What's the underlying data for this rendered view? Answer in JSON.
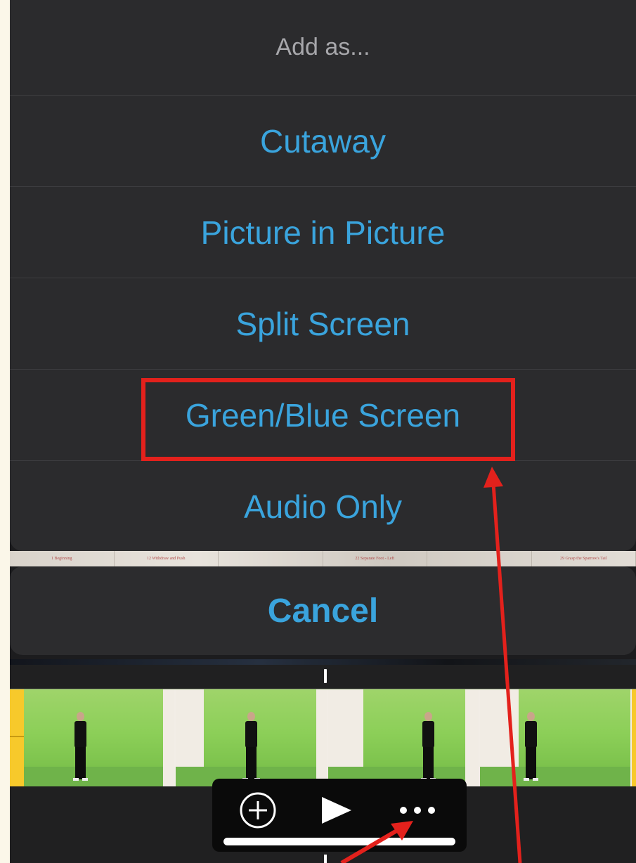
{
  "sheet": {
    "title": "Add as...",
    "options": [
      {
        "label": "Cutaway"
      },
      {
        "label": "Picture in Picture"
      },
      {
        "label": "Split Screen"
      },
      {
        "label": "Green/Blue Screen"
      },
      {
        "label": "Audio Only"
      }
    ]
  },
  "cancel": {
    "label": "Cancel"
  },
  "background_strip": {
    "labels": [
      "1 Beginning",
      "12 Withdraw and Push",
      "22 Separate Foot - Left",
      "29 Grasp the Sparrow's Tail"
    ]
  },
  "toolbar": {
    "icons": [
      "add-circle-icon",
      "play-icon",
      "more-ellipsis-icon"
    ]
  },
  "colors": {
    "accent": "#3aa4dd",
    "annotation": "#e3211c",
    "sheet_bg": "#2b2b2d",
    "clip_edge": "#f7c92b",
    "page_bg": "#fbf7e9"
  }
}
